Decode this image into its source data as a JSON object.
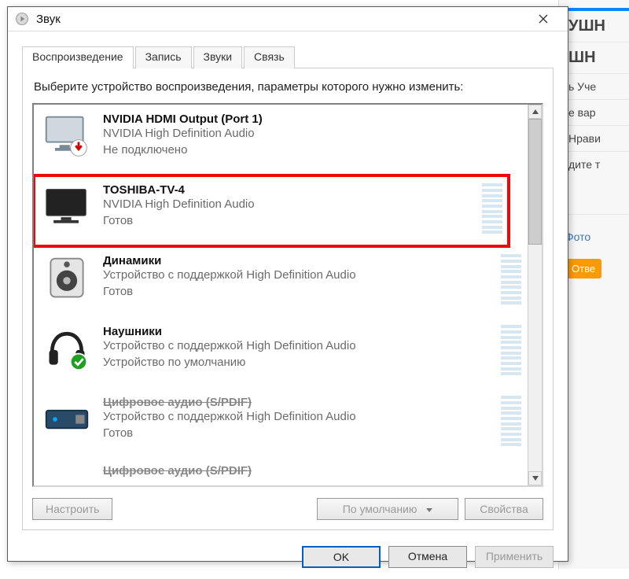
{
  "dialog": {
    "title": "Звук",
    "tabs": [
      {
        "label": "Воспроизведение",
        "active": true
      },
      {
        "label": "Запись"
      },
      {
        "label": "Звуки"
      },
      {
        "label": "Связь"
      }
    ],
    "help_text": "Выберите устройство воспроизведения, параметры которого нужно изменить:",
    "devices": [
      {
        "name": "NVIDIA HDMI Output (Port 1)",
        "desc": "NVIDIA High Definition Audio",
        "status": "Не подключено",
        "icon": "monitor-disconnected",
        "highlighted": false,
        "meter": false
      },
      {
        "name": "TOSHIBA-TV-4",
        "desc": "NVIDIA High Definition Audio",
        "status": "Готов",
        "icon": "tv",
        "highlighted": true,
        "meter": true
      },
      {
        "name": "Динамики",
        "desc": "Устройство с поддержкой High Definition Audio",
        "status": "Готов",
        "icon": "speaker",
        "highlighted": false,
        "meter": true
      },
      {
        "name": "Наушники",
        "desc": "Устройство с поддержкой High Definition Audio",
        "status": "Устройство по умолчанию",
        "icon": "headphones-default",
        "highlighted": false,
        "meter": true
      },
      {
        "name": "Цифровое аудио (S/PDIF)",
        "desc": "Устройство с поддержкой High Definition Audio",
        "status": "Готов",
        "icon": "spdif",
        "highlighted": false,
        "meter": true,
        "name_struck": true
      },
      {
        "name": "Цифровое аудио (S/PDIF)",
        "desc": "",
        "status": "",
        "icon": "",
        "highlighted": false,
        "meter": false,
        "name_struck": true,
        "trailing": true
      }
    ],
    "buttons": {
      "configure": "Настроить",
      "default": "По умолчанию",
      "properties": "Свойства",
      "ok": "OK",
      "cancel": "Отмена",
      "apply": "Применить"
    }
  },
  "backdrop": {
    "items": [
      "УШН",
      "ШН",
      "ь Уче",
      "е вар",
      "Нрави",
      "дите т"
    ],
    "link": "Фото",
    "btn": "Отве"
  }
}
